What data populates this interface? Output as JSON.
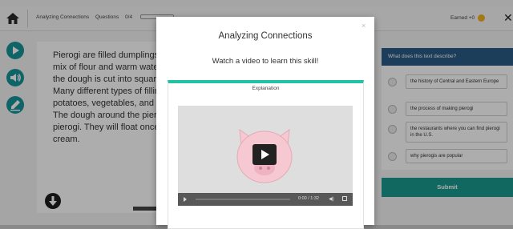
{
  "topbar": {
    "skill_name": "Analyzing Connections",
    "questions_label": "Questions",
    "questions_count": "0/4",
    "earned_label": "Earned +0",
    "close_glyph": "✕"
  },
  "passage": {
    "text": "Pierogi are filled dumplings. They are made from dough with a mix of flour and warm water. Someone rolls out the dough. First, the dough is cut into squares or circles. Next, the dough is filled. Many different types of filling that are popular fillings are mashed potatoes, vegetables, and meat. Then they put the filling inside. The dough around the pierogi are then folded in half. Boil the pierogi. They will float once ready. Serve with butter or sour cream."
  },
  "question": {
    "prompt": "What does this text describe?",
    "options": [
      "the history of Central and Eastern Europe",
      "the process of making pierogi",
      "the restaurants where you can find pierogi in the U.S.",
      "why pierogis are popular"
    ],
    "submit_label": "Submit"
  },
  "modal": {
    "title": "Analyzing Connections",
    "subtitle": "Watch a video to learn this skill!",
    "close_glyph": "×",
    "card_title": "Explanation",
    "video_time": "0:00 / 1:32"
  },
  "colors": {
    "accent_teal": "#17949a",
    "header_blue": "#2a5c86",
    "card_stripe": "#22c2a5",
    "submit_green": "#1a9a8f",
    "coin_gold": "#f2b21b",
    "pig_pink": "#f6c9d2"
  },
  "icons": {
    "home": "home-icon",
    "play_tool": "play-circle-icon",
    "audio_tool": "speaker-icon",
    "pencil_tool": "pencil-icon",
    "scroll_down": "arrow-down-icon",
    "coin": "coin-icon"
  }
}
